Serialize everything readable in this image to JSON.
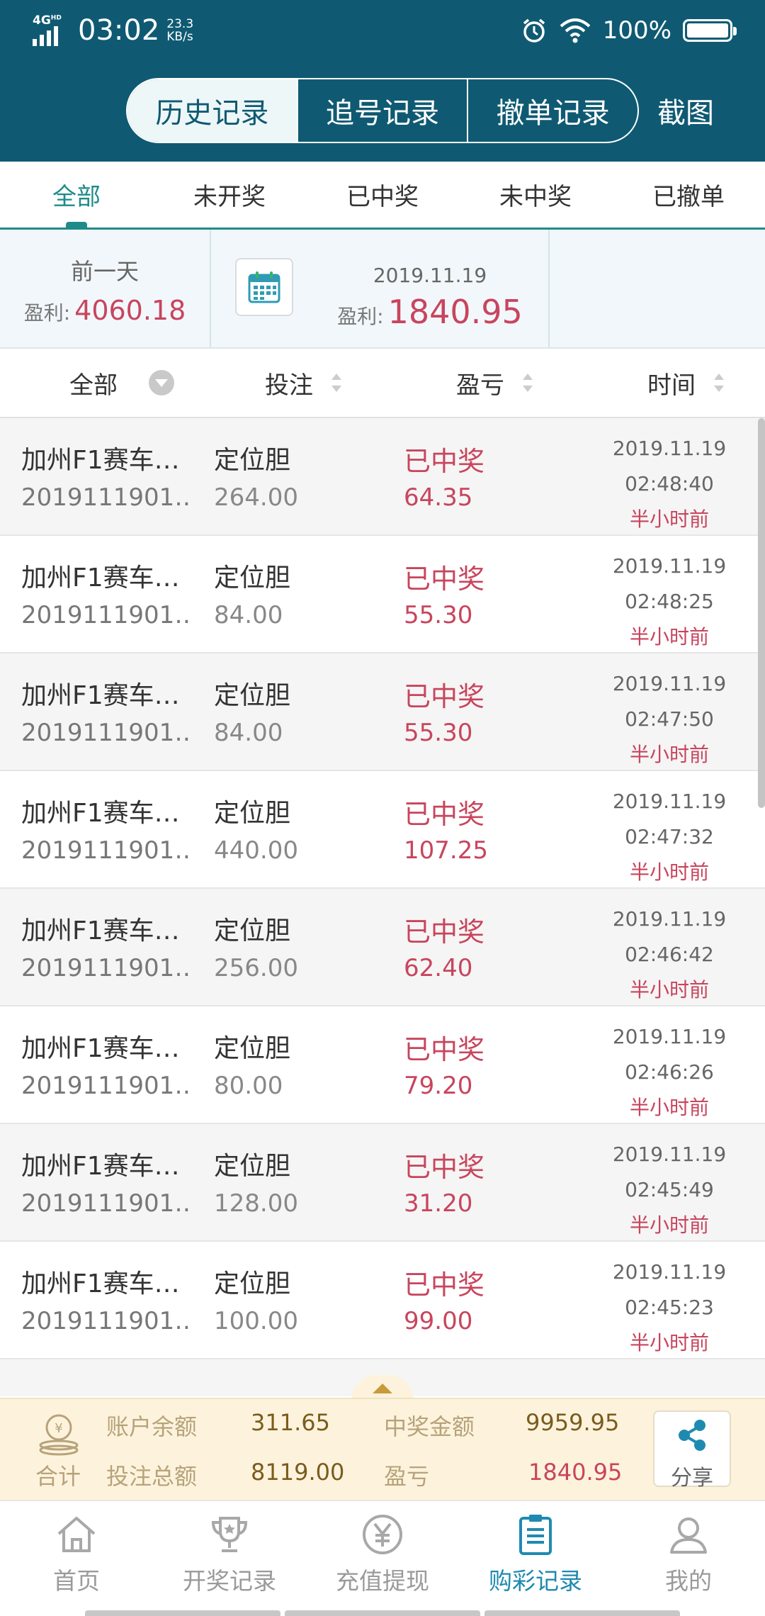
{
  "status_bar": {
    "network": "4G",
    "network_hd": "HD",
    "time": "03:02",
    "speed_value": "23.3",
    "speed_unit": "KB/s",
    "battery": "100%"
  },
  "header": {
    "segments": [
      {
        "label": "历史记录",
        "active": true
      },
      {
        "label": "追号记录",
        "active": false
      },
      {
        "label": "撤单记录",
        "active": false
      }
    ],
    "screenshot_label": "截图"
  },
  "tabs": [
    {
      "label": "全部",
      "active": true
    },
    {
      "label": "未开奖",
      "active": false
    },
    {
      "label": "已中奖",
      "active": false
    },
    {
      "label": "未中奖",
      "active": false
    },
    {
      "label": "已撤单",
      "active": false
    }
  ],
  "summary": {
    "prev_day_label": "前一天",
    "prev_profit_label": "盈利:",
    "prev_profit_value": "4060.18",
    "date": "2019.11.19",
    "today_profit_label": "盈利:",
    "today_profit_value": "1840.95"
  },
  "columns": {
    "all": "全部",
    "bet": "投注",
    "profit_loss": "盈亏",
    "time": "时间"
  },
  "rows": [
    {
      "game": "加州F1赛车…",
      "issue": "2019111901…",
      "play": "定位胆",
      "amount": "264.00",
      "status": "已中奖",
      "payout": "64.35",
      "date": "2019.11.19",
      "clock": "02:48:40",
      "ago": "半小时前"
    },
    {
      "game": "加州F1赛车…",
      "issue": "2019111901…",
      "play": "定位胆",
      "amount": "84.00",
      "status": "已中奖",
      "payout": "55.30",
      "date": "2019.11.19",
      "clock": "02:48:25",
      "ago": "半小时前"
    },
    {
      "game": "加州F1赛车…",
      "issue": "2019111901…",
      "play": "定位胆",
      "amount": "84.00",
      "status": "已中奖",
      "payout": "55.30",
      "date": "2019.11.19",
      "clock": "02:47:50",
      "ago": "半小时前"
    },
    {
      "game": "加州F1赛车…",
      "issue": "2019111901…",
      "play": "定位胆",
      "amount": "440.00",
      "status": "已中奖",
      "payout": "107.25",
      "date": "2019.11.19",
      "clock": "02:47:32",
      "ago": "半小时前"
    },
    {
      "game": "加州F1赛车…",
      "issue": "2019111901…",
      "play": "定位胆",
      "amount": "256.00",
      "status": "已中奖",
      "payout": "62.40",
      "date": "2019.11.19",
      "clock": "02:46:42",
      "ago": "半小时前"
    },
    {
      "game": "加州F1赛车…",
      "issue": "2019111901…",
      "play": "定位胆",
      "amount": "80.00",
      "status": "已中奖",
      "payout": "79.20",
      "date": "2019.11.19",
      "clock": "02:46:26",
      "ago": "半小时前"
    },
    {
      "game": "加州F1赛车…",
      "issue": "2019111901…",
      "play": "定位胆",
      "amount": "128.00",
      "status": "已中奖",
      "payout": "31.20",
      "date": "2019.11.19",
      "clock": "02:45:49",
      "ago": "半小时前"
    },
    {
      "game": "加州F1赛车…",
      "issue": "2019111901…",
      "play": "定位胆",
      "amount": "100.00",
      "status": "已中奖",
      "payout": "99.00",
      "date": "2019.11.19",
      "clock": "02:45:23",
      "ago": "半小时前"
    }
  ],
  "totals": {
    "label": "合计",
    "balance_label": "账户余额",
    "balance_value": "311.65",
    "win_label": "中奖金额",
    "win_value": "9959.95",
    "bet_total_label": "投注总额",
    "bet_total_value": "8119.00",
    "pl_label": "盈亏",
    "pl_value": "1840.95",
    "share_label": "分享"
  },
  "nav": [
    {
      "label": "首页",
      "icon": "home-icon",
      "active": false
    },
    {
      "label": "开奖记录",
      "icon": "trophy-icon",
      "active": false
    },
    {
      "label": "充值提现",
      "icon": "yen-icon",
      "active": false
    },
    {
      "label": "购彩记录",
      "icon": "clipboard-icon",
      "active": true
    },
    {
      "label": "我的",
      "icon": "user-icon",
      "active": false
    }
  ],
  "colors": {
    "header_bg": "#0f5a72",
    "accent": "#1f8a8a",
    "profit_red": "#c8455d",
    "nav_active": "#1f8ab0",
    "totals_bg": "#fdf3dd"
  }
}
